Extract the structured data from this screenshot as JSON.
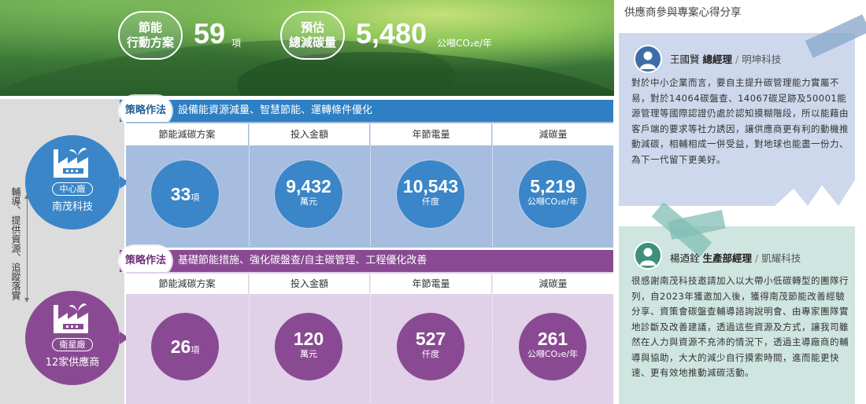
{
  "hero": {
    "stat1": {
      "label": "節能\n行動方案",
      "value": "59",
      "unit": "項"
    },
    "stat2": {
      "label": "預估\n總減碳量",
      "value": "5,480",
      "unit": "公噸CO₂e/年"
    }
  },
  "rail": {
    "text": "輔導、提供資源、追蹤落實"
  },
  "center_factory": {
    "tag": "中心廠",
    "name": "南茂科技"
  },
  "satellite_factory": {
    "tag": "衛星廠",
    "name": "12家供應商"
  },
  "columns": [
    "節能減碳方案",
    "投入金額",
    "年節電量",
    "減碳量"
  ],
  "strategy1": {
    "tag": "策略作法",
    "text": "設備能資源減量、智慧節能、運轉條件優化",
    "values": [
      {
        "num": "33",
        "unit": "項"
      },
      {
        "num": "9,432",
        "unit": "萬元"
      },
      {
        "num": "10,543",
        "unit": "仟度"
      },
      {
        "num": "5,219",
        "unit": "公噸CO₂e/年"
      }
    ]
  },
  "strategy2": {
    "tag": "策略作法",
    "text": "基礎節能措施、強化碳盤查/自主碳管理、工程優化改善",
    "values": [
      {
        "num": "26",
        "unit": "項"
      },
      {
        "num": "120",
        "unit": "萬元"
      },
      {
        "num": "527",
        "unit": "仟度"
      },
      {
        "num": "261",
        "unit": "公噸CO₂e/年"
      }
    ]
  },
  "right": {
    "title": "供應商參與專案心得分享",
    "note1": {
      "name": "王國賢",
      "role": "總經理",
      "company": "明坤科技",
      "quote": "對於中小企業而言，要自主提升碳管理能力實屬不易，對於14064碳盤查、14067碳足跡及50001能源管理等國際認證仍處於認知摸糊階段，所以能藉由客戶端的要求等社力誘因，讓供應商更有利的動機推動減碳，相輔相成一併受益，對地球也能盡一份力、為下一代留下更美好。"
    },
    "note2": {
      "name": "楊迺銓",
      "role": "生產部經理",
      "company": "凱耀科技",
      "quote": "很感謝南茂科技邀請加入以大帶小低碳轉型的團隊行列，自2023年獲邀加入後，獲得南茂節能改善經驗分享、資策會碳盤查輔導諮詢說明會、由專家團隊實地診斷及改善建議，透過這些資源及方式，讓我司雖然在人力與資源不充沛的情況下，透過主導廠商的輔導與協助，大大的減少自行摸索時間，進而能更快速、更有效地推動減碳活動。"
    }
  }
}
